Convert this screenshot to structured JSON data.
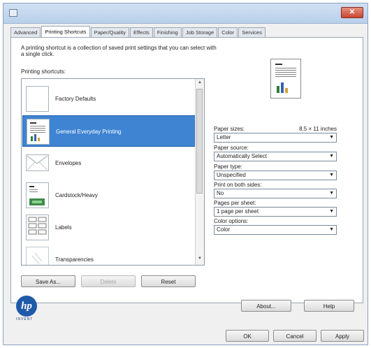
{
  "window": {
    "close_glyph": "✕"
  },
  "tabs": [
    {
      "label": "Advanced",
      "active": false
    },
    {
      "label": "Printing Shortcuts",
      "active": true
    },
    {
      "label": "Paper/Quality",
      "active": false
    },
    {
      "label": "Effects",
      "active": false
    },
    {
      "label": "Finishing",
      "active": false
    },
    {
      "label": "Job Storage",
      "active": false
    },
    {
      "label": "Color",
      "active": false
    },
    {
      "label": "Services",
      "active": false
    }
  ],
  "description": "A printing shortcut is a collection of saved print settings that you can select with a single click.",
  "shortcuts_label": "Printing shortcuts:",
  "shortcuts": [
    {
      "label": "Factory Defaults",
      "icon": "blank-page-icon",
      "selected": false
    },
    {
      "label": "General Everyday Printing",
      "icon": "document-icon",
      "selected": true
    },
    {
      "label": "Envelopes",
      "icon": "envelope-icon",
      "selected": false
    },
    {
      "label": "Cardstock/Heavy",
      "icon": "cardstock-icon",
      "selected": false
    },
    {
      "label": "Labels",
      "icon": "labels-icon",
      "selected": false
    },
    {
      "label": "Transparencies",
      "icon": "transparency-icon",
      "selected": false
    }
  ],
  "buttons": {
    "save_as": "Save As...",
    "delete": "Delete",
    "reset": "Reset",
    "about": "About...",
    "help": "Help",
    "ok": "OK",
    "cancel": "Cancel",
    "apply": "Apply"
  },
  "paper_sizes": {
    "label": "Paper sizes:",
    "dimensions": "8.5 × 11 inches",
    "value": "Letter"
  },
  "paper_source": {
    "label": "Paper source:",
    "value": "Automatically Select"
  },
  "paper_type": {
    "label": "Paper type:",
    "value": "Unspecified"
  },
  "duplex": {
    "label": "Print on both sides:",
    "value": "No"
  },
  "pages_per_sheet": {
    "label": "Pages per sheet:",
    "value": "1 page per sheet"
  },
  "color_options": {
    "label": "Color options:",
    "value": "Color"
  },
  "logo": {
    "text": "hp",
    "tagline": "INVENT"
  },
  "colors": {
    "selection": "#3f84d3",
    "logo": "#1f5aa8",
    "close": "#c84732"
  }
}
